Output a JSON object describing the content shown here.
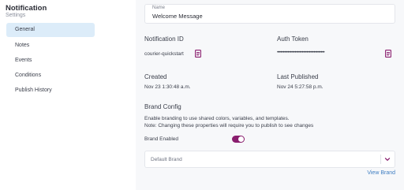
{
  "sidebar": {
    "title": "Notification",
    "subtitle": "Settings",
    "items": [
      {
        "label": "General"
      },
      {
        "label": "Notes"
      },
      {
        "label": "Events"
      },
      {
        "label": "Conditions"
      },
      {
        "label": "Publish History"
      }
    ]
  },
  "main": {
    "name_field": {
      "label": "Name",
      "value": "Welcome Message"
    },
    "notification_id": {
      "label": "Notification ID",
      "value": "courier-quickstart"
    },
    "auth_token": {
      "label": "Auth Token",
      "value": "••••••••••••••••••••••••••••••••••••••••"
    },
    "created": {
      "label": "Created",
      "value": "Nov 23 1:30:48 a.m."
    },
    "last_published": {
      "label": "Last Published",
      "value": "Nov 24 5:27:58 p.m."
    },
    "brand_config": {
      "heading": "Brand Config",
      "description": "Enable branding to use shared colors, variables, and templates.",
      "note": "Note: Changing these properties will require you to publish to see changes",
      "brand_enabled_label": "Brand Enabled",
      "brand_enabled": true,
      "brand_select_value": "Default Brand",
      "view_brand_link": "View Brand"
    }
  },
  "colors": {
    "accent": "#8a1e6e",
    "active_nav": "#dcecf9",
    "link": "#3f7ec2",
    "main_bg": "#f7f8fa"
  },
  "icons": {
    "copy": "copy-icon",
    "chevron": "chevron-down-icon"
  }
}
